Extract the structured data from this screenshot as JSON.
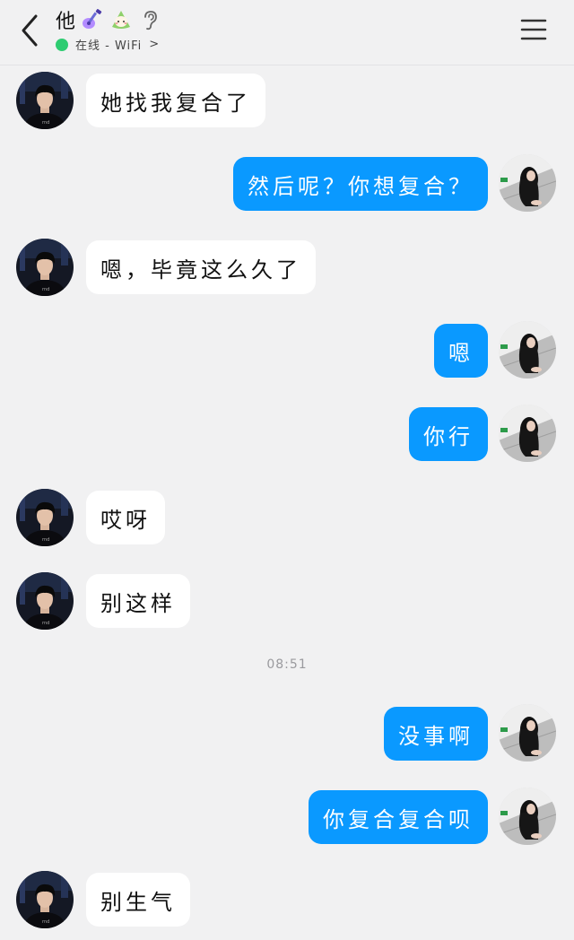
{
  "header": {
    "title": "他",
    "status": "在线 - WiFi",
    "status_chevron": ">",
    "status_color": "#2ecc71",
    "icons": [
      "back-arrow-icon",
      "guitar-badge-icon",
      "rice-ball-badge-icon",
      "ear-icon",
      "menu-icon"
    ]
  },
  "colors": {
    "outgoing_bubble": "#0a99ff",
    "incoming_bubble": "#ffffff",
    "background": "#f1f1f2"
  },
  "messages": [
    {
      "side": "in",
      "text": "她找我复合了"
    },
    {
      "side": "out",
      "text": "然后呢？你想复合？"
    },
    {
      "side": "in",
      "text": "嗯，毕竟这么久了"
    },
    {
      "side": "out",
      "text": "嗯"
    },
    {
      "side": "out",
      "text": "你行"
    },
    {
      "side": "in",
      "text": "哎呀"
    },
    {
      "side": "in",
      "text": "别这样"
    },
    {
      "side": "out",
      "text": "没事啊"
    },
    {
      "side": "out",
      "text": "你复合复合呗"
    },
    {
      "side": "in",
      "text": "别生气"
    }
  ],
  "timestamp": "08:51"
}
